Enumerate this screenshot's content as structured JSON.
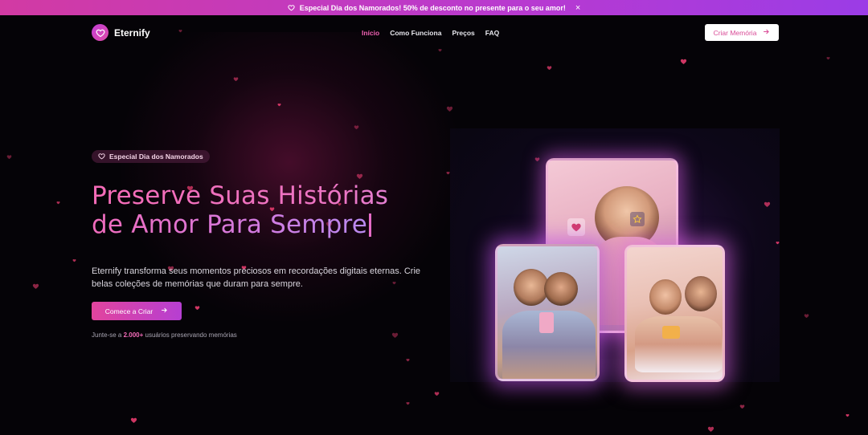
{
  "banner": {
    "text": "Especial Dia dos Namorados! 50% de desconto no presente para o seu amor!",
    "close": "×"
  },
  "brand": {
    "name": "Eternify"
  },
  "nav": {
    "items": [
      {
        "label": "Início",
        "active": true
      },
      {
        "label": "Como Funciona",
        "active": false
      },
      {
        "label": "Preços",
        "active": false
      },
      {
        "label": "FAQ",
        "active": false
      }
    ],
    "cta": "Criar Memória"
  },
  "hero": {
    "badge": "Especial Dia dos Namorados",
    "headline_line1": "Preserve Suas Histórias",
    "headline_line2": "de Amor Para Sempre",
    "description": "Eternify transforma seus momentos preciosos em recordações digitais eternas. Crie belas coleções de memórias que duram para sempre.",
    "cta": "Comece a Criar",
    "social_prefix": "Junte-se a ",
    "social_count": "2.000+",
    "social_suffix": " usuários preservando memórias"
  },
  "colors": {
    "accent_pink": "#f062b4",
    "accent_purple": "#b63fd2",
    "background": "#050307",
    "banner_start": "#d23aa3",
    "banner_end": "#9b3ce6"
  },
  "icons": {
    "banner": "heart-outline-icon",
    "logo": "heart-outline-icon",
    "badge": "heart-outline-icon",
    "cta_arrow": "arrow-right-icon",
    "card_heart": "heart-icon",
    "card_star": "star-icon"
  }
}
